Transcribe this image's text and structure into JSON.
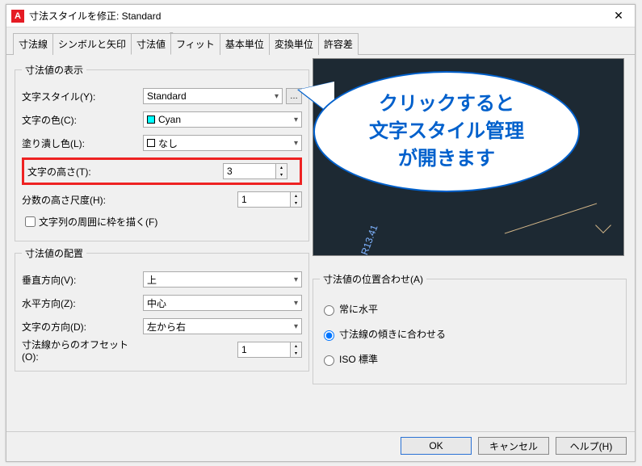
{
  "window": {
    "title": "寸法スタイルを修正: Standard"
  },
  "tabs": [
    "寸法線",
    "シンボルと矢印",
    "寸法値",
    "フィット",
    "基本単位",
    "変換単位",
    "許容差"
  ],
  "active_tab": 2,
  "text_display": {
    "legend": "寸法値の表示",
    "style_label": "文字スタイル(Y):",
    "style_value": "Standard",
    "color_label": "文字の色(C):",
    "color_value": "Cyan",
    "fill_label": "塗り潰し色(L):",
    "fill_value": "なし",
    "height_label": "文字の高さ(T):",
    "height_value": "3",
    "fraction_label": "分数の高さ尺度(H):",
    "fraction_value": "1",
    "frame_label": "文字列の周囲に枠を描く(F)"
  },
  "text_placement": {
    "legend": "寸法値の配置",
    "vertical_label": "垂直方向(V):",
    "vertical_value": "上",
    "horizontal_label": "水平方向(Z):",
    "horizontal_value": "中心",
    "direction_label": "文字の方向(D):",
    "direction_value": "左から右",
    "offset_label": "寸法線からのオフセット(O):",
    "offset_value": "1"
  },
  "alignment": {
    "legend": "寸法値の位置合わせ(A)",
    "horiz": "常に水平",
    "aligned": "寸法線の傾きに合わせる",
    "iso": "ISO 標準",
    "selected": "aligned"
  },
  "preview": {
    "radius_label": "R13.41"
  },
  "balloon": {
    "line1": "クリックすると",
    "line2": "文字スタイル管理",
    "line3": "が開きます"
  },
  "buttons": {
    "ok": "OK",
    "cancel": "キャンセル",
    "help": "ヘルプ(H)"
  },
  "colors": {
    "cyan": "#00ffff",
    "none": "#ffffff"
  }
}
